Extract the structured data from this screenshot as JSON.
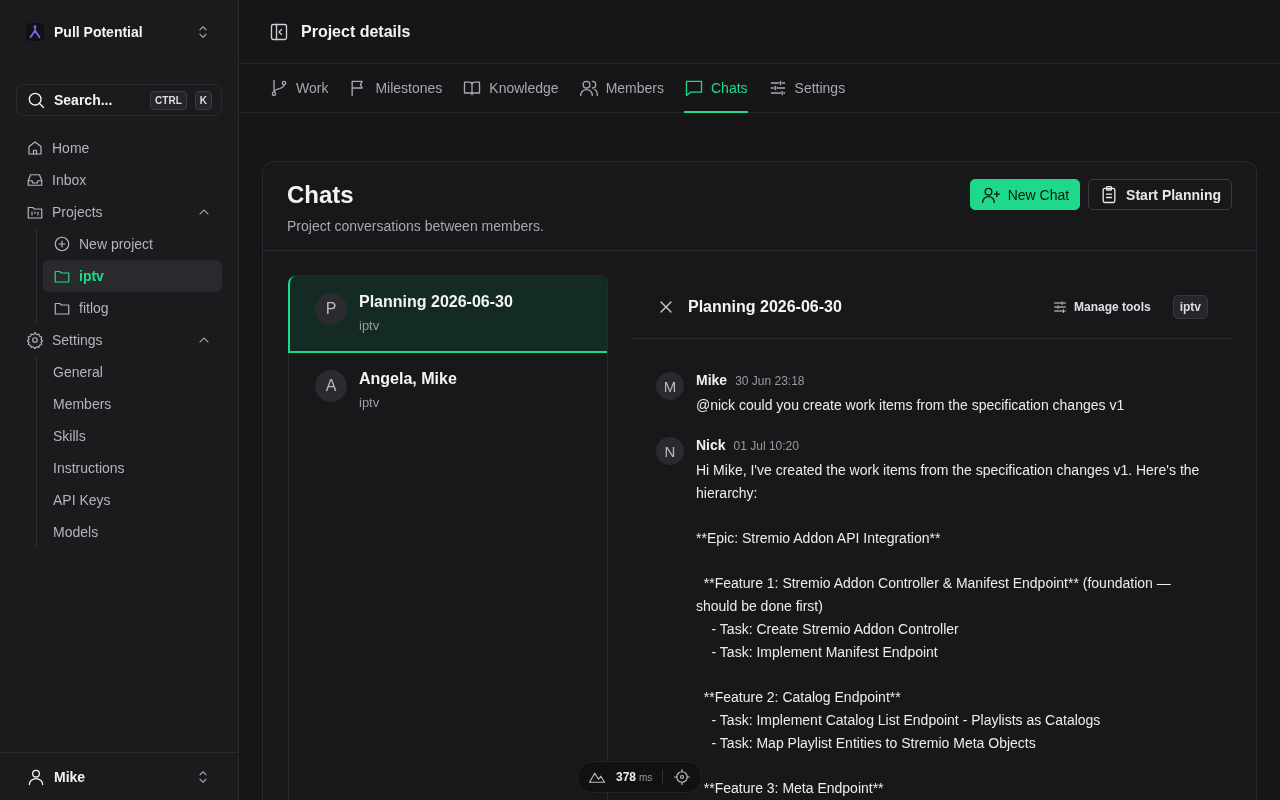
{
  "sidebar": {
    "workspace": "Pull Potential",
    "search": {
      "label": "Search...",
      "keys": [
        "CTRL",
        "K"
      ]
    },
    "nav": [
      {
        "label": "Home",
        "kind": "home"
      },
      {
        "label": "Inbox",
        "kind": "inbox"
      },
      {
        "label": "Projects",
        "kind": "projects",
        "expanded": true,
        "children": [
          {
            "label": "New project",
            "kind": "plus",
            "selected": false
          },
          {
            "label": "iptv",
            "kind": "folder",
            "selected": true
          },
          {
            "label": "fitlog",
            "kind": "folder",
            "selected": false
          }
        ]
      },
      {
        "label": "Settings",
        "kind": "gear",
        "expanded": true,
        "children": [
          {
            "label": "General",
            "selected": false
          },
          {
            "label": "Members",
            "selected": false
          },
          {
            "label": "Skills",
            "selected": false
          },
          {
            "label": "Instructions",
            "selected": false
          },
          {
            "label": "API Keys",
            "selected": false
          },
          {
            "label": "Models",
            "selected": false
          }
        ]
      }
    ],
    "user": "Mike"
  },
  "header": {
    "title": "Project details"
  },
  "tabs": [
    {
      "label": "Work",
      "kind": "branch",
      "selected": false
    },
    {
      "label": "Milestones",
      "kind": "flag",
      "selected": false
    },
    {
      "label": "Knowledge",
      "kind": "book",
      "selected": false
    },
    {
      "label": "Members",
      "kind": "users",
      "selected": false
    },
    {
      "label": "Chats",
      "kind": "chat",
      "selected": true
    },
    {
      "label": "Settings",
      "kind": "sliders",
      "selected": false
    }
  ],
  "chats": {
    "title": "Chats",
    "subtitle": "Project conversations between members.",
    "buttons": [
      {
        "label": "New Chat",
        "kind": "primary"
      },
      {
        "label": "Start Planning",
        "kind": "secondary"
      }
    ],
    "list": [
      {
        "initial": "P",
        "title": "Planning 2026-06-30",
        "project": "iptv",
        "selected": true
      },
      {
        "initial": "A",
        "title": "Angela, Mike",
        "project": "iptv",
        "selected": false
      }
    ],
    "detail": {
      "title": "Planning 2026-06-30",
      "manage_tools": "Manage tools",
      "badge": "iptv",
      "messages": [
        {
          "initial": "M",
          "author": "Mike",
          "time": "30 Jun 23:18",
          "paragraphs": [
            [
              "@nick could you create work items from the specification changes v1"
            ]
          ]
        },
        {
          "initial": "N",
          "author": "Nick",
          "time": "01 Jul 10:20",
          "paragraphs": [
            [
              "Hi Mike, I've created the work items from the specification changes v1. Here's the hierarchy:"
            ],
            [
              "**Epic: Stremio Addon API Integration**"
            ],
            [
              "  **Feature 1: Stremio Addon Controller & Manifest Endpoint** (foundation — should be done first)",
              "    - Task: Create Stremio Addon Controller",
              "    - Task: Implement Manifest Endpoint"
            ],
            [
              "  **Feature 2: Catalog Endpoint**",
              "    - Task: Implement Catalog List Endpoint - Playlists as Catalogs",
              "    - Task: Map Playlist Entities to Stremio Meta Objects"
            ],
            [
              "  **Feature 3: Meta Endpoint**"
            ]
          ]
        }
      ]
    }
  },
  "dev_toolbar": {
    "value": "378",
    "unit": "ms"
  }
}
